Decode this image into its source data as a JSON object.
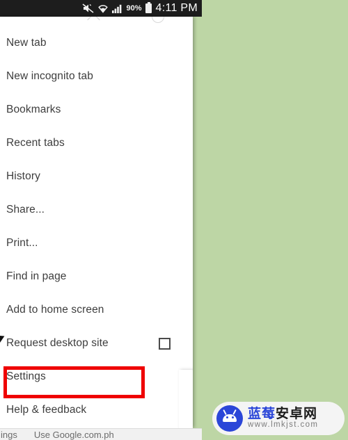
{
  "status_bar": {
    "icons": [
      "mute-icon",
      "wifi-icon",
      "signal-icon"
    ],
    "battery_percent": "90%",
    "battery_icon": "battery-icon",
    "time": "4:11 PM"
  },
  "menu": {
    "items": [
      {
        "label": "New tab",
        "name": "menu-item-new-tab",
        "checkbox": false
      },
      {
        "label": "New incognito tab",
        "name": "menu-item-new-incognito-tab",
        "checkbox": false
      },
      {
        "label": "Bookmarks",
        "name": "menu-item-bookmarks",
        "checkbox": false
      },
      {
        "label": "Recent tabs",
        "name": "menu-item-recent-tabs",
        "checkbox": false
      },
      {
        "label": "History",
        "name": "menu-item-history",
        "checkbox": false
      },
      {
        "label": "Share...",
        "name": "menu-item-share",
        "checkbox": false
      },
      {
        "label": "Print...",
        "name": "menu-item-print",
        "checkbox": false
      },
      {
        "label": "Find in page",
        "name": "menu-item-find-in-page",
        "checkbox": false
      },
      {
        "label": "Add to home screen",
        "name": "menu-item-add-to-home-screen",
        "checkbox": false
      },
      {
        "label": "Request desktop site",
        "name": "menu-item-request-desktop-site",
        "checkbox": true
      },
      {
        "label": "Settings",
        "name": "menu-item-settings",
        "checkbox": false
      },
      {
        "label": "Help & feedback",
        "name": "menu-item-help-feedback",
        "checkbox": false
      }
    ]
  },
  "highlight": {
    "target_label": "Settings",
    "color": "#ef0000"
  },
  "page_bottom": {
    "left_text": "ings",
    "center_text": "Use Google.com.ph"
  },
  "watermark": {
    "brand_blue": "蓝莓",
    "brand_dark": "安卓网",
    "url": "www.lmkjst.com",
    "logo": "android-robot-icon",
    "accent_color": "#2b46d8"
  },
  "colors": {
    "background": "#bdd6a5",
    "panel": "#ffffff",
    "status_bar": "#1d1d1d",
    "menu_text": "#3d3d3d"
  }
}
